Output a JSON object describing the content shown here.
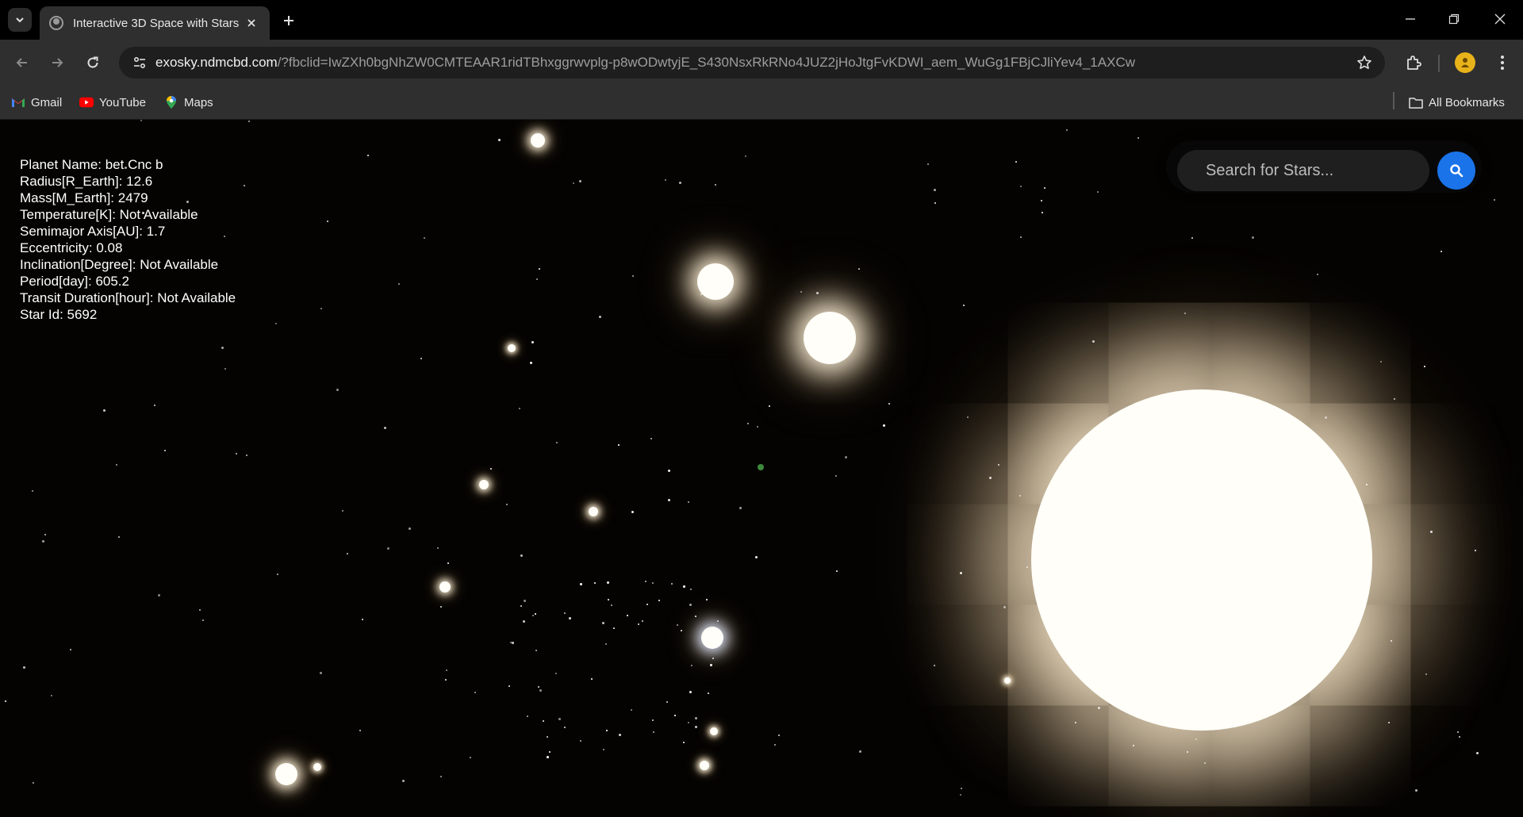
{
  "browser": {
    "tab_title": "Interactive 3D Space with Stars",
    "url_host": "exosky.ndmcbd.com",
    "url_rest": "/?fbclid=IwZXh0bgNhZW0CMTEAAR1ridTBhxggrwvplg-p8wODwtyjE_S430NsxRkRNo4JUZ2jHoJtgFvKDWI_aem_WuGg1FBjCJliYev4_1AXCw",
    "bookmarks": [
      {
        "label": "Gmail",
        "icon": "gmail-icon"
      },
      {
        "label": "YouTube",
        "icon": "youtube-icon"
      },
      {
        "label": "Maps",
        "icon": "maps-icon"
      }
    ],
    "all_bookmarks_label": "All Bookmarks"
  },
  "planet_info": [
    "Planet Name: bet Cnc b",
    "Radius[R_Earth]: 12.6",
    "Mass[M_Earth]: 2479",
    "Temperature[K]: Not Available",
    "Semimajor Axis[AU]: 1.7",
    "Eccentricity: 0.08",
    "Inclination[Degree]: Not Available",
    "Period[day]: 605.2",
    "Transit Duration[hour]: Not Available",
    "Star Id: 5692"
  ],
  "search": {
    "placeholder": "Search for Stars..."
  },
  "colors": {
    "search_button": "#1a73e8",
    "chrome_background": "#2f2f2f",
    "space_background": "#040302",
    "star_warm": "#fff4dc",
    "star_cool": "#dfe8ff"
  }
}
